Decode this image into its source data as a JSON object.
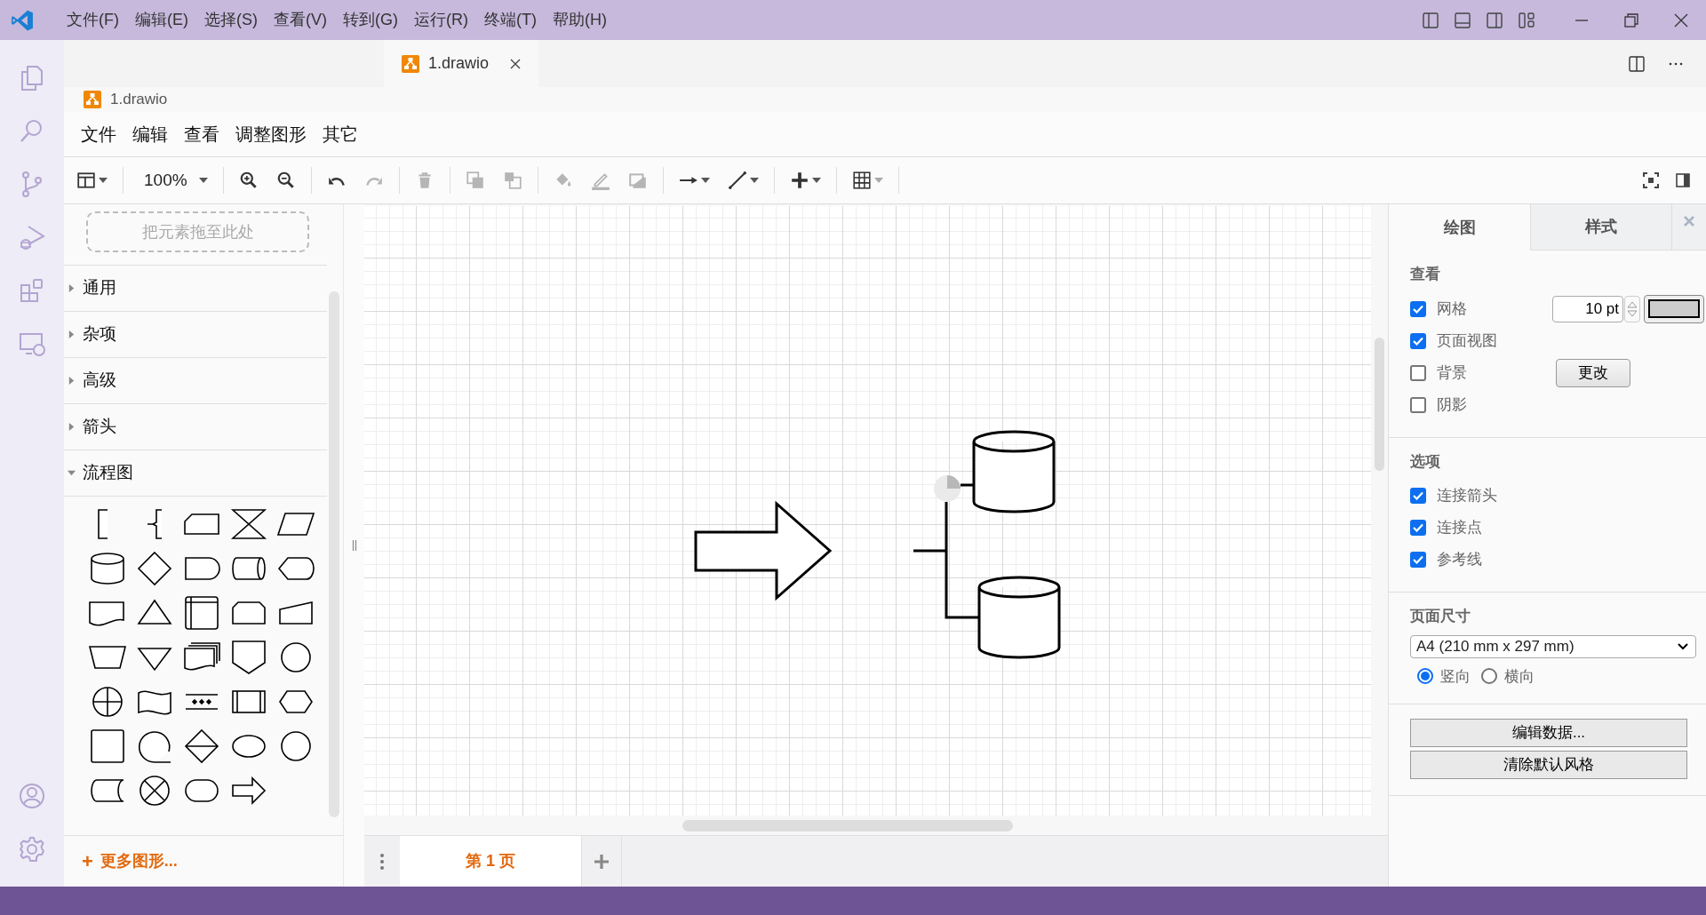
{
  "title_bar": {
    "menu": [
      "文件(F)",
      "编辑(E)",
      "选择(S)",
      "查看(V)",
      "转到(G)",
      "运行(R)",
      "终端(T)",
      "帮助(H)"
    ]
  },
  "editor_tabs": [
    {
      "label": "1.drawio",
      "selected": true
    }
  ],
  "breadcrumb": "1.drawio",
  "drawio_menu": [
    "文件",
    "编辑",
    "查看",
    "调整图形",
    "其它"
  ],
  "toolbar": {
    "groups": [
      [
        {
          "kind": "layout",
          "disabled": false
        }
      ],
      [
        {
          "kind": "zoom",
          "label": "100%",
          "disabled": false
        }
      ],
      [
        {
          "kind": "zoomin",
          "disabled": false
        },
        {
          "kind": "zoomout",
          "disabled": false
        }
      ],
      [
        {
          "kind": "undo",
          "disabled": false
        },
        {
          "kind": "redo",
          "disabled": true
        }
      ],
      [
        {
          "kind": "delete",
          "disabled": true
        }
      ],
      [
        {
          "kind": "tofront",
          "disabled": true
        },
        {
          "kind": "toback",
          "disabled": true
        }
      ],
      [
        {
          "kind": "fill",
          "disabled": true
        },
        {
          "kind": "linecolor",
          "disabled": true
        },
        {
          "kind": "shadow",
          "disabled": true
        }
      ],
      [
        {
          "kind": "connection",
          "disabled": false
        },
        {
          "kind": "waypoint",
          "disabled": false
        }
      ],
      [
        {
          "kind": "insert",
          "disabled": false
        }
      ],
      [
        {
          "kind": "table",
          "disabled": false
        }
      ]
    ],
    "right": [
      {
        "kind": "fullscreen",
        "disabled": false
      },
      {
        "kind": "panel",
        "disabled": false
      }
    ]
  },
  "shapes_panel": {
    "drop_zone": "把元素拖至此处",
    "categories": [
      {
        "label": "通用",
        "expanded": false
      },
      {
        "label": "杂项",
        "expanded": false
      },
      {
        "label": "高级",
        "expanded": false
      },
      {
        "label": "箭头",
        "expanded": false
      },
      {
        "label": "流程图",
        "expanded": true
      }
    ],
    "more_shapes": {
      "icon": "+",
      "label": "更多图形..."
    }
  },
  "format_panel": {
    "tabs": [
      {
        "label": "绘图",
        "selected": true
      },
      {
        "label": "样式",
        "selected": false
      }
    ],
    "view": {
      "heading": "查看",
      "options": [
        {
          "label": "网格",
          "checked": true,
          "value": "10 pt"
        },
        {
          "label": "页面视图",
          "checked": true
        },
        {
          "label": "背景",
          "checked": false,
          "button": "更改"
        },
        {
          "label": "阴影",
          "checked": false
        }
      ]
    },
    "options": {
      "heading": "选项",
      "items": [
        {
          "label": "连接箭头",
          "checked": true
        },
        {
          "label": "连接点",
          "checked": true
        },
        {
          "label": "参考线",
          "checked": true
        }
      ]
    },
    "page_size": {
      "heading": "页面尺寸",
      "value": "A4 (210 mm x 297 mm)",
      "orientation": [
        {
          "label": "竖向",
          "selected": true
        },
        {
          "label": "横向",
          "selected": false
        }
      ]
    },
    "buttons": [
      "编辑数据...",
      "清除默认风格"
    ]
  },
  "pages": [
    {
      "label": "第 1 页",
      "selected": true
    }
  ]
}
